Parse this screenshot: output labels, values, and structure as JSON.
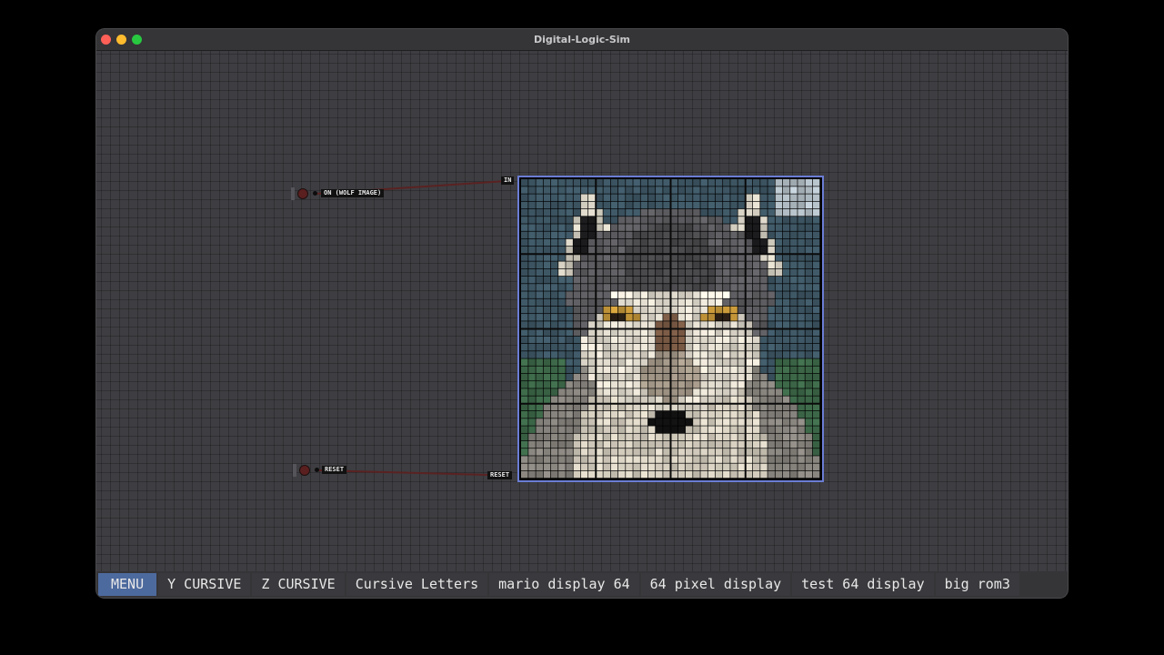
{
  "window": {
    "title": "Digital-Logic-Sim"
  },
  "pins": {
    "input_on_label": "ON (WOLF IMAGE)",
    "input_reset_label": "RESET",
    "chip_in_label": "IN",
    "chip_reset_label": "RESET"
  },
  "colors": {
    "wire": "#5a2222",
    "display_border": "#6b7dd4",
    "menu_button": "#4d6a9e"
  },
  "taskbar": {
    "items": [
      {
        "label": "MENU"
      },
      {
        "label": "Y CURSIVE"
      },
      {
        "label": "Z CURSIVE"
      },
      {
        "label": "Cursive Letters"
      },
      {
        "label": "mario display 64"
      },
      {
        "label": "64 pixel display"
      },
      {
        "label": "test 64 display"
      },
      {
        "label": "big rom3"
      }
    ]
  },
  "display": {
    "columns": 40,
    "rows": 40,
    "sections": 4,
    "image": "wolf-portrait"
  }
}
